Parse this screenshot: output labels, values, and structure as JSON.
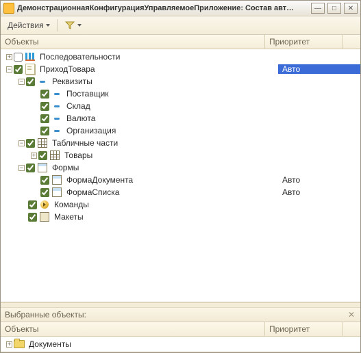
{
  "window": {
    "title": "ДемонстрационнаяКонфигурацияУправляемоеПриложение: Состав авт…"
  },
  "toolbar": {
    "actions_label": "Действия"
  },
  "columns": {
    "objects": "Объекты",
    "priority": "Приоритет"
  },
  "tree": [
    {
      "indent": 0,
      "exp": "plus",
      "checked": false,
      "icon": "seq",
      "name": "Последовательности",
      "prio": ""
    },
    {
      "indent": 0,
      "exp": "minus",
      "checked": true,
      "icon": "doc",
      "name": "ПриходТовара",
      "prio": "Авто",
      "selected": true
    },
    {
      "indent": 1,
      "exp": "minus",
      "checked": true,
      "icon": "attr",
      "name": "Реквизиты",
      "prio": ""
    },
    {
      "indent": 2,
      "exp": "",
      "checked": true,
      "icon": "attr",
      "name": "Поставщик",
      "prio": ""
    },
    {
      "indent": 2,
      "exp": "",
      "checked": true,
      "icon": "attr",
      "name": "Склад",
      "prio": ""
    },
    {
      "indent": 2,
      "exp": "",
      "checked": true,
      "icon": "attr",
      "name": "Валюта",
      "prio": ""
    },
    {
      "indent": 2,
      "exp": "",
      "checked": true,
      "icon": "attr",
      "name": "Организация",
      "prio": ""
    },
    {
      "indent": 1,
      "exp": "minus",
      "checked": true,
      "icon": "table",
      "name": "Табличные части",
      "prio": ""
    },
    {
      "indent": 2,
      "exp": "plus",
      "checked": true,
      "icon": "table",
      "name": "Товары",
      "prio": ""
    },
    {
      "indent": 1,
      "exp": "minus",
      "checked": true,
      "icon": "form",
      "name": "Формы",
      "prio": ""
    },
    {
      "indent": 2,
      "exp": "",
      "checked": true,
      "icon": "form",
      "name": "ФормаДокумента",
      "prio": "Авто"
    },
    {
      "indent": 2,
      "exp": "",
      "checked": true,
      "icon": "form",
      "name": "ФормаСписка",
      "prio": "Авто"
    },
    {
      "indent": 1,
      "exp": "",
      "checked": true,
      "icon": "cmd",
      "name": "Команды",
      "prio": ""
    },
    {
      "indent": 1,
      "exp": "",
      "checked": true,
      "icon": "tpl",
      "name": "Макеты",
      "prio": ""
    }
  ],
  "selected_panel": {
    "label": "Выбранные объекты:"
  },
  "selected_tree": [
    {
      "indent": 0,
      "exp": "plus",
      "icon": "folder",
      "name": "Документы",
      "prio": ""
    }
  ]
}
